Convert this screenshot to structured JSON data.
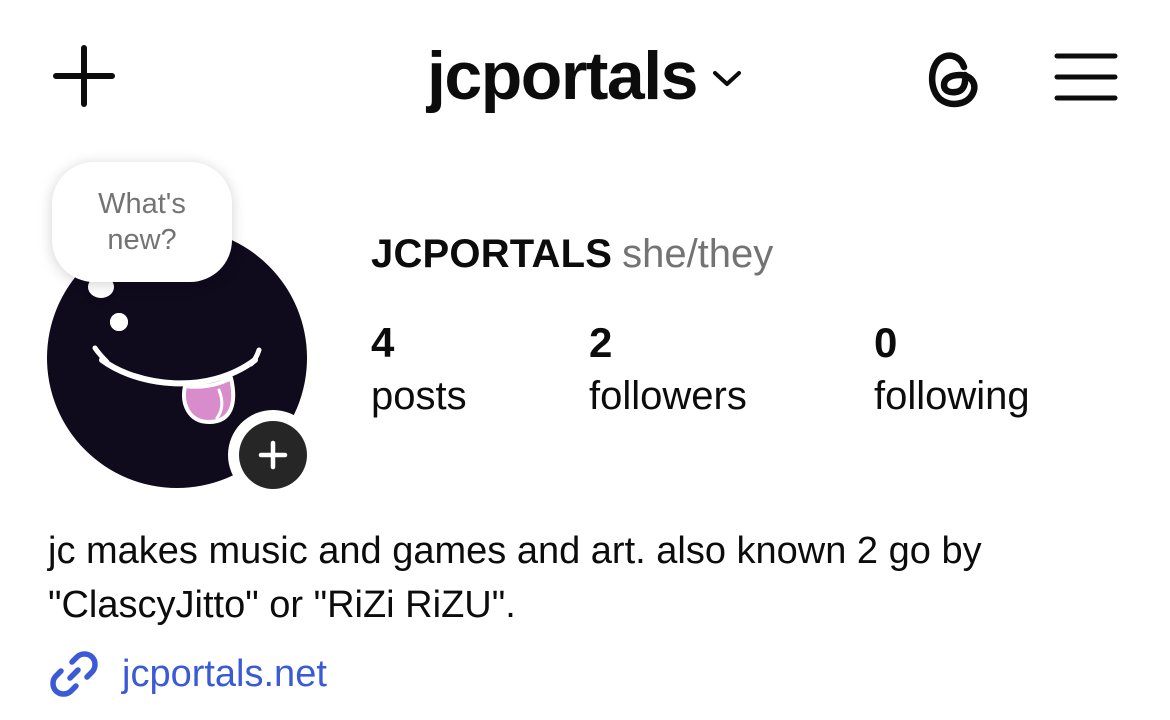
{
  "header": {
    "create_icon": "plus-icon",
    "username": "jcportals",
    "switch_account_icon": "chevron-down-icon",
    "threads_icon": "threads-icon",
    "menu_icon": "hamburger-menu-icon"
  },
  "note": {
    "text": "What's new?"
  },
  "avatar": {
    "icon": "smiley-tongue-avatar",
    "add_story_icon": "plus-icon"
  },
  "profile": {
    "display_name": "JCPORTALS",
    "pronouns": "she/they"
  },
  "stats": [
    {
      "count": "4",
      "label": "posts"
    },
    {
      "count": "2",
      "label": "followers"
    },
    {
      "count": "0",
      "label": "following"
    }
  ],
  "bio": {
    "text": "jc makes music and games and art. also known 2 go by \"ClascyJitto\" or \"RiZi RiZU\".",
    "link_icon": "link-icon",
    "link": "jcportals.net"
  },
  "colors": {
    "text": "#0c0c0c",
    "secondary_text": "#737373",
    "link": "#3b5bd6",
    "avatar_background": "#0f0a1c",
    "tongue": "#d98ccc"
  }
}
